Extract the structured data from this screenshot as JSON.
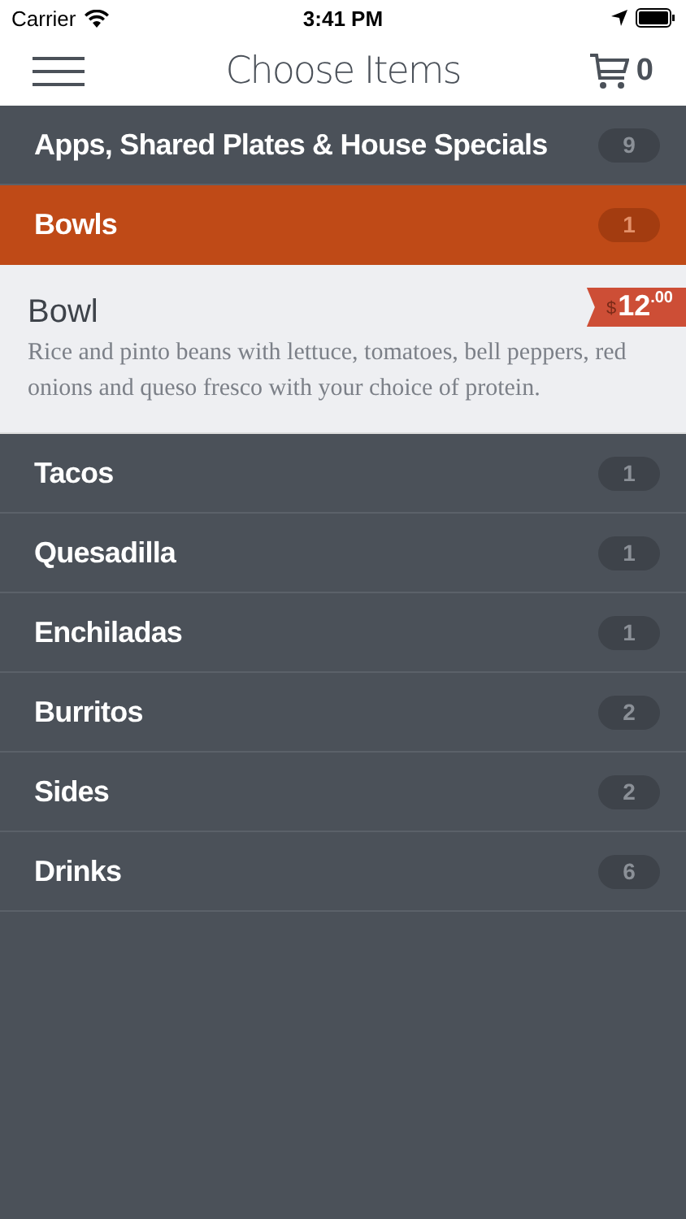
{
  "status_bar": {
    "carrier": "Carrier",
    "time": "3:41 PM"
  },
  "nav": {
    "title": "Choose Items",
    "cart_count": "0"
  },
  "categories": [
    {
      "name": "Apps, Shared Plates & House Specials",
      "count": "9",
      "selected": false
    },
    {
      "name": "Bowls",
      "count": "1",
      "selected": true,
      "items": [
        {
          "name": "Bowl",
          "currency": "$",
          "price": "12",
          "cents": ".00",
          "description": "Rice and pinto beans with lettuce, tomatoes, bell peppers, red onions and queso fresco with your choice of protein."
        }
      ]
    },
    {
      "name": "Tacos",
      "count": "1",
      "selected": false
    },
    {
      "name": "Quesadilla",
      "count": "1",
      "selected": false
    },
    {
      "name": "Enchiladas",
      "count": "1",
      "selected": false
    },
    {
      "name": "Burritos",
      "count": "2",
      "selected": false
    },
    {
      "name": "Sides",
      "count": "2",
      "selected": false
    },
    {
      "name": "Drinks",
      "count": "6",
      "selected": false
    }
  ]
}
